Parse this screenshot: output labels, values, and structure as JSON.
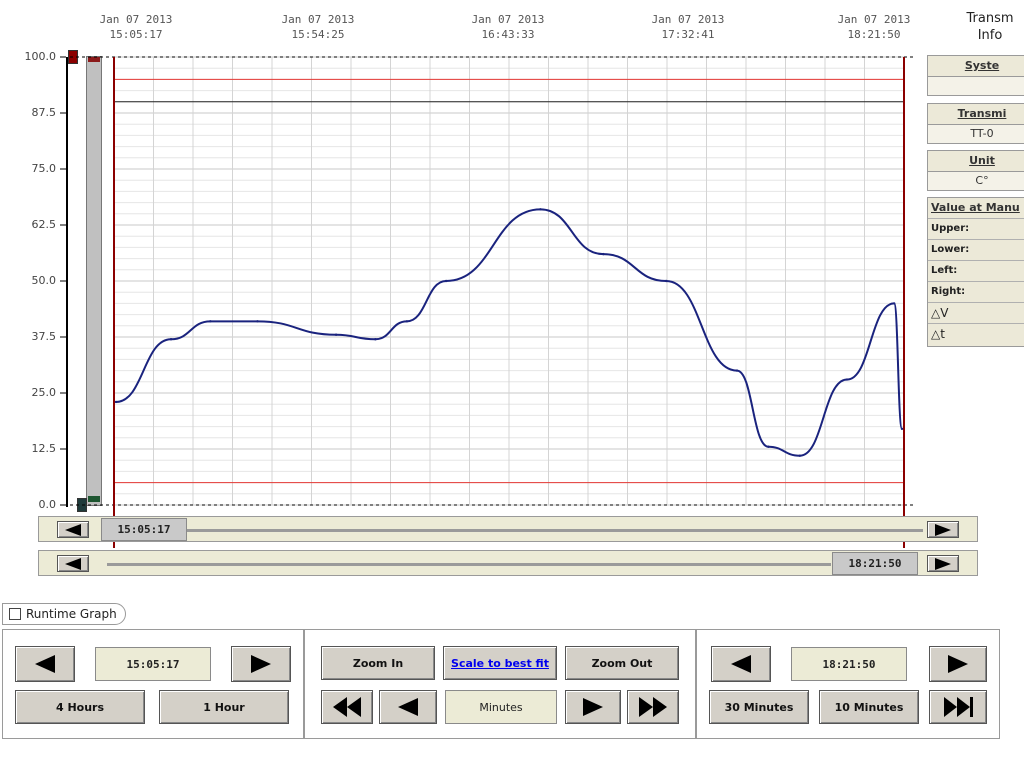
{
  "axis": {
    "top_ticks": [
      {
        "date": "Jan 07 2013",
        "time": "15:05:17"
      },
      {
        "date": "Jan 07 2013",
        "time": "15:54:25"
      },
      {
        "date": "Jan 07 2013",
        "time": "16:43:33"
      },
      {
        "date": "Jan 07 2013",
        "time": "17:32:41"
      },
      {
        "date": "Jan 07 2013",
        "time": "18:21:50"
      }
    ],
    "y_ticks": [
      "100.0",
      "87.5",
      "75.0",
      "62.5",
      "50.0",
      "37.5",
      "25.0",
      "12.5",
      "0.0"
    ]
  },
  "chart_data": {
    "type": "line",
    "x": [
      "15:05:17",
      "15:20",
      "15:30",
      "15:40",
      "16:00",
      "16:10",
      "16:20",
      "16:30",
      "16:45",
      "17:00",
      "17:20",
      "17:40",
      "17:55",
      "18:05",
      "18:15",
      "18:20",
      "18:21:50"
    ],
    "series": [
      {
        "values": [
          23,
          37,
          41,
          41,
          38,
          37,
          41,
          50,
          66,
          56,
          50,
          30,
          13,
          11,
          28,
          45,
          17
        ]
      }
    ],
    "ylim": [
      0,
      100
    ],
    "upper_limit": 95,
    "lower_limit": 5,
    "reference_line": 90,
    "line_color": "#1a237e",
    "limit_color": "#e53935"
  },
  "info_panel": {
    "title_line1": "Transm",
    "title_line2": "Info",
    "system_label": "Syste",
    "system_value": "",
    "transmitter_label": "Transmi",
    "transmitter_value": "TT-0",
    "unit_label": "Unit",
    "unit_value": "C°",
    "value_header": "Value at Manu",
    "rows": [
      "Upper:",
      "Lower:",
      "Left:",
      "Right:",
      "△V",
      "△t"
    ]
  },
  "scrollbars": {
    "start_time": "15:05:17",
    "end_time": "18:21:50"
  },
  "runtime_graph": {
    "label": "Runtime Graph",
    "checked": false
  },
  "controls": {
    "start_time": "15:05:17",
    "end_time": "18:21:50",
    "btn_4hours": "4 Hours",
    "btn_1hour": "1 Hour",
    "zoom_in": "Zoom In",
    "scale_best_fit": "Scale to best fit",
    "zoom_out": "Zoom Out",
    "unit_field": "Minutes",
    "btn_30min": "30 Minutes",
    "btn_10min": "10 Minutes"
  }
}
